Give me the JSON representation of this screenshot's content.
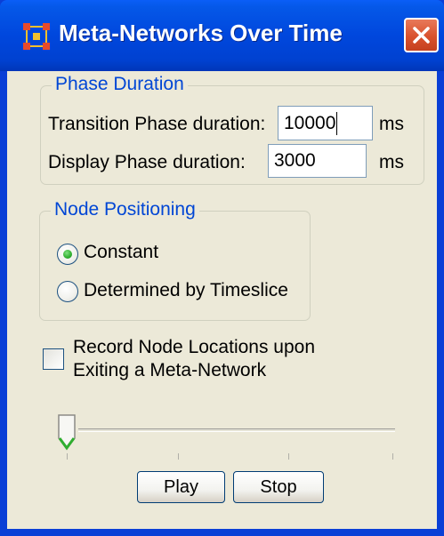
{
  "window": {
    "title": "Meta-Networks Over Time",
    "app_icon": "meta-network-icon",
    "close_icon": "close-icon"
  },
  "phase_duration": {
    "group_title": "Phase Duration",
    "transition_label": "Transition Phase duration:",
    "transition_value": "10000",
    "transition_unit": "ms",
    "display_label": "Display Phase duration:",
    "display_value": "3000",
    "display_unit": "ms"
  },
  "node_positioning": {
    "group_title": "Node Positioning",
    "options": [
      {
        "label": "Constant",
        "selected": true
      },
      {
        "label": "Determined by Timeslice",
        "selected": false
      }
    ]
  },
  "record": {
    "label_line1": "Record Node Locations upon",
    "label_line2": "Exiting a Meta-Network",
    "checked": false
  },
  "slider": {
    "value_fraction": 0.0,
    "tick_count": 4
  },
  "buttons": {
    "play_label": "Play",
    "stop_label": "Stop"
  },
  "colors": {
    "title_bar": "#0047dd",
    "group_title": "#0046d5",
    "client_bg": "#ece9d8",
    "close_button": "#d9512d",
    "radio_selected": "#2fae2f"
  }
}
